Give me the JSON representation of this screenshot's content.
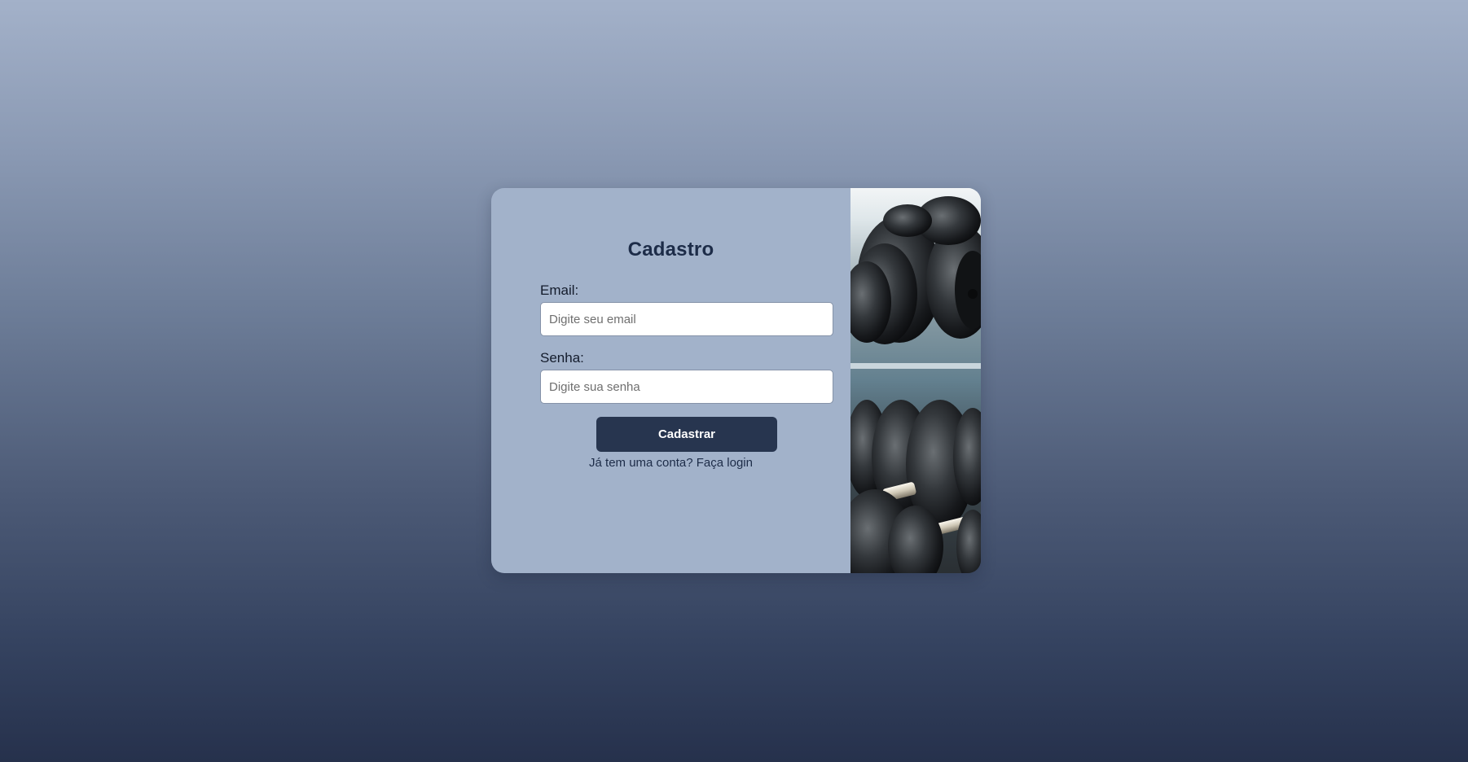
{
  "form": {
    "title": "Cadastro",
    "email_label": "Email:",
    "email_placeholder": "Digite seu email",
    "email_value": "",
    "password_label": "Senha:",
    "password_placeholder": "Digite sua senha",
    "password_value": "",
    "submit_label": "Cadastrar",
    "login_prompt": "Já tem uma conta?",
    "login_link": "Faça login"
  },
  "image": {
    "subject": "dumbbells-rack-photo"
  },
  "colors": {
    "panel_background": "#a2b2ca",
    "button_background": "#27354f",
    "title_color": "#1d2c48",
    "page_gradient_top": "#a3b1c9",
    "page_gradient_bottom": "#26314c"
  }
}
